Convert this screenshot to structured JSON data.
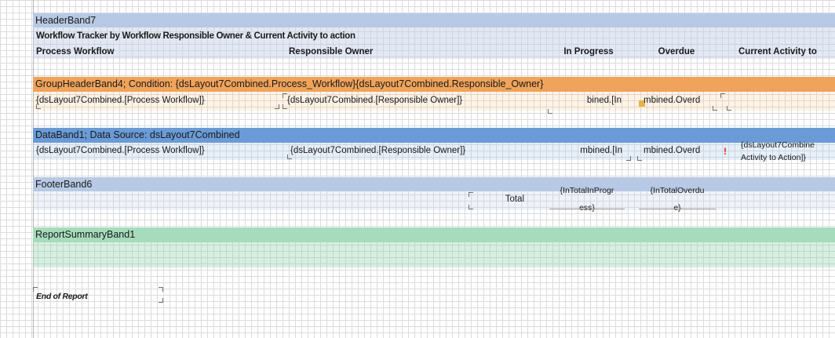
{
  "colors": {
    "header_band": "#b7c9e4",
    "group_band": "#f0a35a",
    "data_band": "#6a9bd6",
    "footer_band": "#b7c9e4",
    "summary_band": "#a6dcbb",
    "warning": "#e02020"
  },
  "bands": {
    "header": {
      "title": "HeaderBand7",
      "report_title": "Workflow Tracker by Workflow Responsible Owner & Current Activity to action",
      "columns": [
        "Process Workflow",
        "Responsible Owner",
        "In Progress",
        "Overdue",
        "Current Activity to"
      ]
    },
    "group": {
      "title": "GroupHeaderBand4;  Condition:  {dsLayout7Combined.Process_Workflow}{dsLayout7Combined.Responsible_Owner}",
      "cells": [
        "{dsLayout7Combined.[Process Workflow]}",
        "{dsLayout7Combined.[Responsible Owner]}",
        "bined.[In",
        "mbined.Overd"
      ]
    },
    "data": {
      "title": "DataBand1;  Data Source:  dsLayout7Combined",
      "cells": [
        "{dsLayout7Combined.[Process Workflow]}",
        "{dsLayout7Combined.[Responsible Owner]}",
        "mbined.[In",
        "mbined.Overd",
        "{dsLayout7Combine",
        "Activity to Action]}"
      ],
      "warning_glyph": "!"
    },
    "footer": {
      "title": "FooterBand6",
      "total_label": "Total",
      "total_inprogress": [
        "{InTotalInProgr",
        "ess}"
      ],
      "total_overdue": [
        "{InTotalOverdu",
        "e}"
      ]
    },
    "summary": {
      "title": "ReportSummaryBand1",
      "end_label": "End of Report"
    }
  }
}
